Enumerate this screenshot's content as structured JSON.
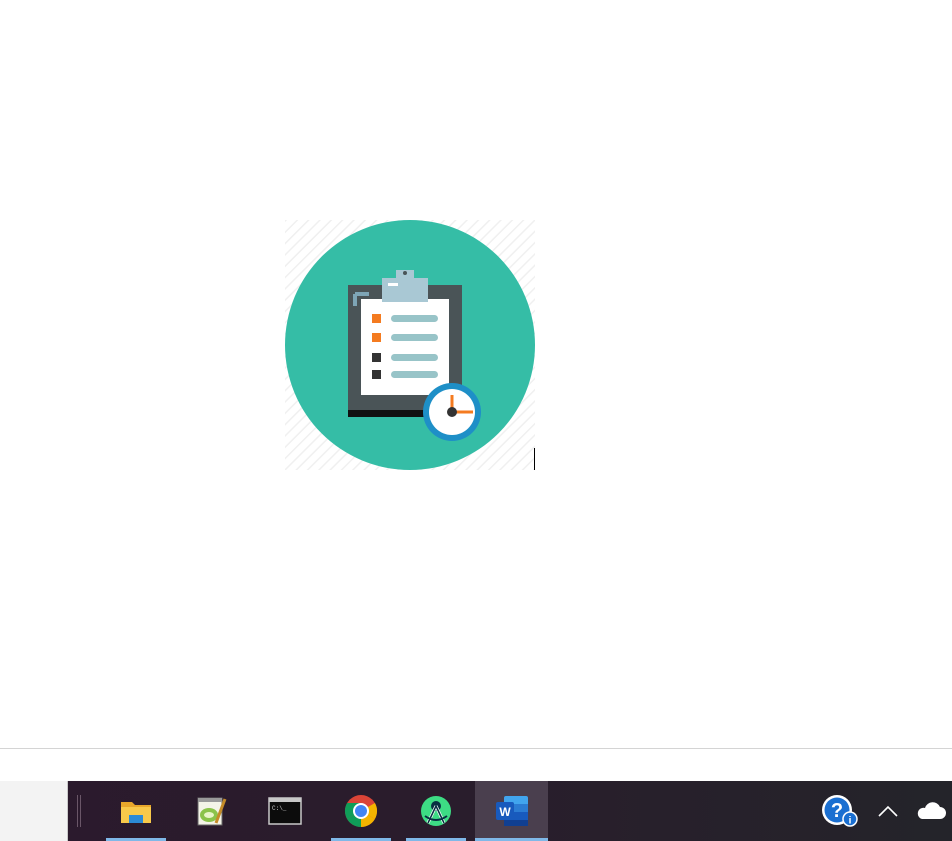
{
  "document": {
    "image_name": "clipboard-checklist-clock-image",
    "checklist_colors": [
      "#f47b20",
      "#f47b20",
      "#333333",
      "#333333"
    ],
    "circle_color": "#35bda6",
    "clock_ring_color": "#1e8fc7"
  },
  "taskbar": {
    "apps": [
      {
        "name": "taskbar-file-explorer",
        "icon": "folder-icon",
        "open": true,
        "active": false
      },
      {
        "name": "taskbar-notepad-plus",
        "icon": "notepad-plus-icon",
        "open": false,
        "active": false
      },
      {
        "name": "taskbar-command-prompt",
        "icon": "terminal-icon",
        "open": false,
        "active": false
      },
      {
        "name": "taskbar-chrome",
        "icon": "chrome-icon",
        "open": true,
        "active": false
      },
      {
        "name": "taskbar-android-studio",
        "icon": "android-studio-icon",
        "open": true,
        "active": false
      },
      {
        "name": "taskbar-word",
        "icon": "word-icon",
        "open": true,
        "active": true
      }
    ],
    "tray": {
      "help_icon": "help-info-icon",
      "overflow_icon": "chevron-up-icon",
      "cloud_icon": "onedrive-cloud-icon"
    },
    "terminal_glyph": "C:\\_",
    "word_letter": "W"
  }
}
